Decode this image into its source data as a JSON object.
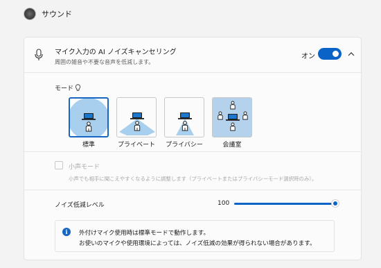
{
  "header": {
    "title": "サウンド"
  },
  "noise_row": {
    "title": "マイク入力の AI ノイズキャンセリング",
    "description": "周囲の雑音や不要な音声を低減します。",
    "toggle_label": "オン",
    "toggle_on": true
  },
  "mode": {
    "label": "モード",
    "options": [
      {
        "label": "標準",
        "selected": true
      },
      {
        "label": "プライベート",
        "selected": false
      },
      {
        "label": "プライバシー",
        "selected": false
      },
      {
        "label": "会議室",
        "selected": false
      }
    ]
  },
  "whisper": {
    "label": "小声モード",
    "description": "小声でも相手に聞こえやすくなるように調整します（プライベートまたはプライバシーモード選択時のみ）。",
    "checked": false,
    "enabled": false
  },
  "noise_level": {
    "label": "ノイズ低減レベル",
    "value": "100",
    "fraction": 1.0
  },
  "info": {
    "line1": "外付けマイク使用時は標準モードで動作します。",
    "line2": "お使いのマイクや使用環境によっては、ノイズ低減の効果が得られない場合があります。"
  },
  "colors": {
    "accent": "#0a64c8",
    "room_bg": "#b4d2ec",
    "beam": "#a8cfee"
  },
  "icons": [
    "app-icon",
    "microphone-icon",
    "chevron-up-icon",
    "lightbulb-icon",
    "laptop-icon",
    "person-icon",
    "info-icon"
  ]
}
